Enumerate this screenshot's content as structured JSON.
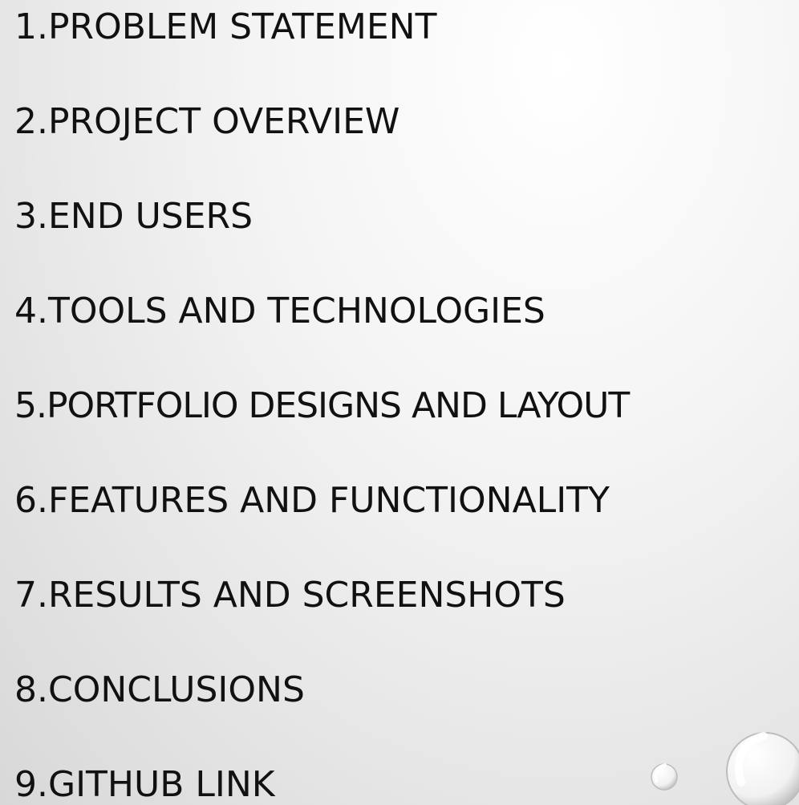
{
  "agenda": {
    "items": [
      "1.PROBLEM STATEMENT",
      "2.PROJECT OVERVIEW",
      "3.END USERS",
      "4.TOOLS AND TECHNOLOGIES",
      "5.PORTFOLIO DESIGNS AND LAYOUT",
      "6.FEATURES AND FUNCTIONALITY",
      "7.RESULTS AND SCREENSHOTS",
      "8.CONCLUSIONS",
      "9.GITHUB LINK"
    ]
  },
  "decoration": {
    "bubble_color": "#ffffff",
    "bubble_edge_color": "#bdbdbd"
  }
}
